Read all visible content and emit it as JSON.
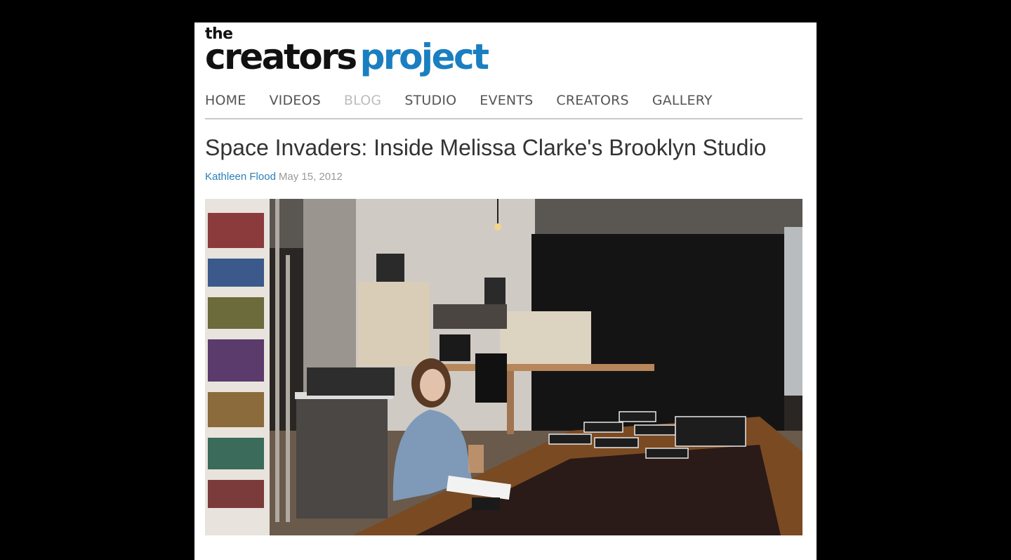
{
  "logo": {
    "the": "the",
    "creators": "creators",
    "project": "project"
  },
  "nav": {
    "items": [
      {
        "label": "HOME"
      },
      {
        "label": "VIDEOS"
      },
      {
        "label": "BLOG"
      },
      {
        "label": "STUDIO"
      },
      {
        "label": "EVENTS"
      },
      {
        "label": "CREATORS"
      },
      {
        "label": "GALLERY"
      }
    ],
    "active": "BLOG"
  },
  "article": {
    "title": "Space Invaders: Inside Melissa Clarke's Brooklyn Studio",
    "author": "Kathleen Flood",
    "date": "May 15, 2012"
  },
  "colors": {
    "brand_blue": "#1a7fc0",
    "link_blue": "#2a7fb8",
    "nav_gray": "#555555",
    "nav_active": "#bdbdbd"
  }
}
